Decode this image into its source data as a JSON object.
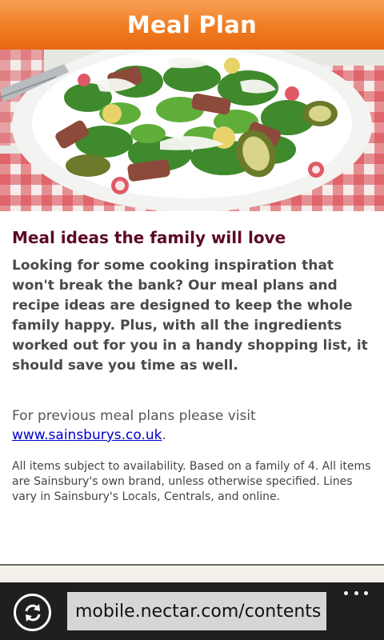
{
  "header": {
    "title": "Meal Plan"
  },
  "article": {
    "headline": "Meal ideas the family will love",
    "intro": "Looking for some cooking inspiration that won't break the bank? Our meal plans and recipe ideas are designed to keep the whole family happy. Plus, with all the ingredients worked out for you in a handy shopping list, it should save you time as well.",
    "previous_text": "For previous meal plans please visit",
    "previous_link": "www.sainsburys.co.uk",
    "previous_after": ".",
    "fine_print": "All items subject to availability. Based on a family of 4. All items are Sainsbury's own brand, unless otherwise specified. Lines vary in Sainsbury's Locals, Centrals, and online."
  },
  "browser": {
    "url": "mobile.nectar.com/contents",
    "refresh_icon": "refresh-icon",
    "more_icon": "more-dots-icon"
  },
  "colors": {
    "header_orange": "#f07c22",
    "headline_maroon": "#5b0a25",
    "link_blue": "#0000cc",
    "appbar_dark": "#1f1f1f"
  }
}
